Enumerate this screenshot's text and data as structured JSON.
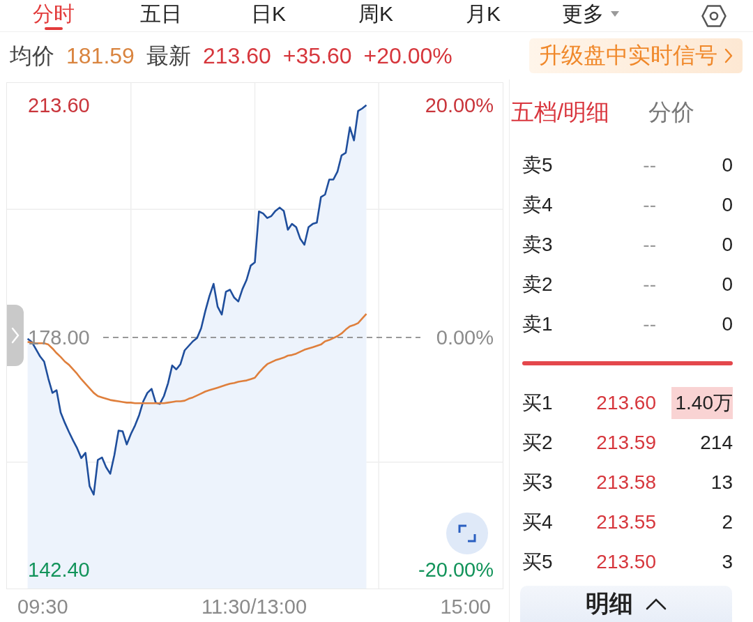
{
  "tabs": [
    {
      "label": "分时",
      "selected": true,
      "kind": "tab"
    },
    {
      "label": "五日",
      "selected": false,
      "kind": "tab"
    },
    {
      "label": "日K",
      "selected": false,
      "kind": "tab"
    },
    {
      "label": "周K",
      "selected": false,
      "kind": "tab"
    },
    {
      "label": "月K",
      "selected": false,
      "kind": "tab"
    },
    {
      "label": "更多",
      "selected": false,
      "kind": "dropdown"
    }
  ],
  "quote": {
    "avg_label": "均价",
    "avg_price": "181.59",
    "last_label": "最新",
    "last_price": "213.60",
    "change": "+35.60",
    "change_percent": "+20.00%"
  },
  "upgrade_button": {
    "label": "升级盘中实时信号"
  },
  "chart": {
    "chart_data": {
      "type": "area",
      "grid": true,
      "categories": [
        null,
        null,
        null,
        null,
        null,
        null,
        null,
        null,
        null,
        null,
        null,
        null,
        null,
        null,
        null,
        null,
        null,
        null,
        null,
        null,
        null,
        null,
        null,
        null,
        null,
        null,
        null,
        null,
        null,
        null,
        null,
        null,
        null,
        null,
        null,
        null,
        null,
        null,
        null,
        null,
        null,
        null,
        null,
        null,
        null,
        null,
        null,
        null,
        null,
        null,
        null,
        null,
        null,
        null,
        null,
        null,
        null,
        null,
        null,
        null,
        null,
        null,
        null,
        null,
        null,
        null,
        null,
        null,
        null,
        null,
        null,
        null,
        null,
        null,
        null,
        null,
        null,
        null,
        null,
        null,
        null,
        null,
        null,
        null,
        null,
        null,
        null,
        null,
        null,
        null,
        null,
        null,
        null,
        null,
        null,
        null,
        null,
        null,
        null,
        null,
        null,
        null,
        null,
        null,
        null,
        null,
        null,
        null,
        null,
        null,
        null,
        null,
        null,
        null,
        null,
        null,
        null,
        null,
        null,
        null,
        null
      ],
      "ylim": [
        139.5,
        217.0
      ],
      "yticks": [
        {
          "value": 213.6,
          "label": "213.60"
        },
        {
          "value": 178,
          "label": "178.00"
        },
        {
          "value": 142.4,
          "label": "142.40"
        }
      ],
      "series": [
        {
          "color": "#1f4e9c",
          "values": [
            null,
            null,
            null,
            null,
            null,
            177.8,
            177.3,
            176.2,
            175.1,
            174.3,
            171.7,
            169.5,
            169.9,
            166.5,
            164.9,
            163.5,
            162.2,
            161.0,
            159.5,
            160.3,
            155.2,
            153.9,
            159.2,
            159.6,
            158.1,
            157.1,
            160.0,
            163.7,
            163.6,
            161.6,
            163.2,
            164.5,
            166.1,
            168.2,
            169.5,
            170.1,
            168.0,
            167.8,
            169.0,
            171.0,
            173.7,
            173.1,
            173.9,
            176.0,
            176.7,
            177.4,
            177.9,
            179.4,
            182.0,
            184.3,
            186.2,
            182.7,
            181.5,
            185.0,
            185.3,
            184.1,
            183.5,
            185.4,
            186.8,
            189.0,
            189.5,
            197.3,
            197.0,
            196.3,
            196.6,
            197.4,
            197.9,
            197.4,
            194.5,
            195.4,
            194.9,
            193.1,
            192.2,
            194.9,
            195.4,
            195.6,
            199.5,
            199.9,
            202.2,
            202.2,
            203.4,
            205.9,
            206.3,
            210.2,
            208.2,
            212.7,
            213.1,
            213.6,
            null,
            null,
            null,
            null,
            null,
            null,
            null,
            null,
            null,
            null,
            null,
            null,
            null,
            null,
            null,
            null,
            null,
            null,
            null,
            null,
            null,
            null,
            null,
            null,
            null,
            null,
            null,
            null,
            null,
            null,
            null,
            null,
            null
          ]
        },
        {
          "type": "line",
          "color": "#df7f3c",
          "values": [
            null,
            null,
            null,
            null,
            null,
            177.3,
            177.2,
            177.1,
            177.1,
            177.1,
            176.9,
            176.3,
            175.6,
            175.0,
            174.3,
            173.8,
            173.1,
            172.4,
            171.6,
            170.9,
            170.2,
            169.5,
            169.0,
            168.8,
            168.6,
            168.4,
            168.3,
            168.2,
            168.1,
            168.0,
            168.0,
            167.9,
            167.9,
            167.9,
            167.9,
            167.9,
            167.9,
            167.9,
            167.9,
            168.0,
            168.1,
            168.2,
            168.2,
            168.3,
            168.6,
            168.8,
            169.1,
            169.4,
            169.7,
            169.9,
            170.1,
            170.3,
            170.5,
            170.7,
            170.9,
            171.0,
            171.2,
            171.3,
            171.4,
            171.6,
            171.8,
            172.6,
            173.3,
            173.9,
            174.2,
            174.5,
            174.7,
            174.9,
            175.2,
            175.3,
            175.5,
            175.8,
            176.1,
            176.3,
            176.5,
            176.7,
            176.9,
            177.4,
            177.6,
            177.9,
            178.2,
            178.6,
            179.2,
            179.7,
            179.9,
            180.2,
            180.9,
            181.6,
            null,
            null,
            null,
            null,
            null,
            null,
            null,
            null,
            null,
            null,
            null,
            null,
            null,
            null,
            null,
            null,
            null,
            null,
            null,
            null,
            null,
            null,
            null,
            null,
            null,
            null,
            null,
            null,
            null,
            null,
            null,
            null,
            null
          ]
        }
      ]
    },
    "right_axis_labels": [
      "20.00%",
      "0.00%",
      "-20.00%"
    ],
    "x_axis_labels": [
      "09:30",
      "11:30/13:00",
      "15:00"
    ]
  },
  "order_book": {
    "tabs": [
      {
        "label": "五档/明细",
        "selected": true
      },
      {
        "label": "分价",
        "selected": false
      }
    ],
    "asks": [
      {
        "label": "卖5",
        "price": "--",
        "volume": "0"
      },
      {
        "label": "卖4",
        "price": "--",
        "volume": "0"
      },
      {
        "label": "卖3",
        "price": "--",
        "volume": "0"
      },
      {
        "label": "卖2",
        "price": "--",
        "volume": "0"
      },
      {
        "label": "卖1",
        "price": "--",
        "volume": "0"
      }
    ],
    "bids": [
      {
        "label": "买1",
        "price": "213.60",
        "volume": "1.40万",
        "highlighted": true
      },
      {
        "label": "买2",
        "price": "213.59",
        "volume": "214",
        "highlighted": false
      },
      {
        "label": "买3",
        "price": "213.58",
        "volume": "13",
        "highlighted": false
      },
      {
        "label": "买4",
        "price": "213.55",
        "volume": "2",
        "highlighted": false
      },
      {
        "label": "买5",
        "price": "213.50",
        "volume": "3",
        "highlighted": false
      }
    ],
    "detail_button": {
      "label": "明细"
    }
  }
}
